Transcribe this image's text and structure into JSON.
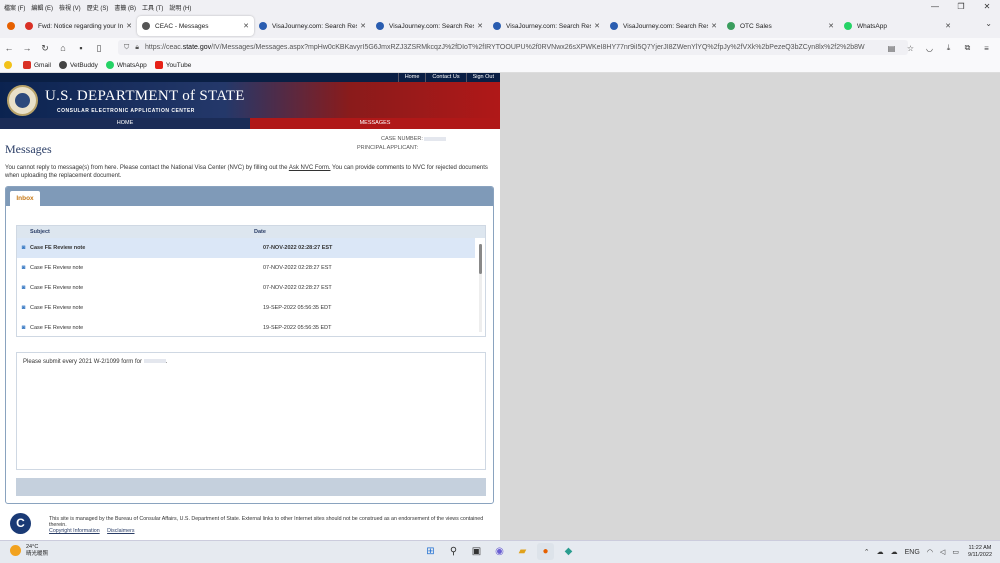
{
  "menubar": {
    "items": [
      "檔案 (F)",
      "編輯 (E)",
      "檢視 (V)",
      "歷史 (S)",
      "書籤 (B)",
      "工具 (T)",
      "說明 (H)"
    ]
  },
  "tabs": [
    {
      "label": "Fwd: Notice regarding your In",
      "color": "#d93025"
    },
    {
      "label": "CEAC - Messages",
      "color": "#555555",
      "active": true
    },
    {
      "label": "VisaJourney.com: Search Resu",
      "color": "#2a5db0"
    },
    {
      "label": "VisaJourney.com: Search Resu",
      "color": "#2a5db0"
    },
    {
      "label": "VisaJourney.com: Search Resu",
      "color": "#2a5db0"
    },
    {
      "label": "VisaJourney.com: Search Resu",
      "color": "#2a5db0"
    },
    {
      "label": "OTC Sales",
      "color": "#3a9d5d"
    },
    {
      "label": "WhatsApp",
      "color": "#25d366"
    }
  ],
  "url": {
    "prefix": "https://ceac.",
    "host": "state.gov",
    "path": "/IV/Messages/Messages.aspx?mpHw0cKBKavyrI5G6JmxRZJ3ZSRMkcqzJ%2fDIoT%2fIRYTOOUPU%2f0RVNwx26sXPWKeI8HY77nr9iI5Q7YjerJI8ZWenYlYQ%2fpJy%2fVXk%2bPezeQ3bZCyn8lx%2f2%2b8W"
  },
  "bookmarks": [
    {
      "label": "Gmail",
      "color": "#d93025"
    },
    {
      "label": "VetBuddy",
      "color": "#444444"
    },
    {
      "label": "WhatsApp",
      "color": "#25d366"
    },
    {
      "label": "YouTube",
      "color": "#e62117"
    }
  ],
  "site": {
    "top_links": [
      "Home",
      "Contact Us",
      "Sign Out"
    ],
    "dept_title": "U.S. DEPARTMENT of STATE",
    "dept_subtitle": "CONSULAR ELECTRONIC APPLICATION CENTER",
    "nav_home": "HOME",
    "nav_messages": "MESSAGES",
    "case_number_label": "CASE NUMBER:",
    "principal_applicant_label": "PRINCIPAL APPLICANT:",
    "page_title": "Messages",
    "notice_pre": "You cannot reply to message(s) from here.  Please contact the National Visa Center (NVC) by filling out the ",
    "notice_link": "Ask NVC Form.",
    "notice_post": "  You can provide comments to NVC for rejected documents when uploading the replacement document.",
    "inbox_tab": "Inbox",
    "col_subject": "Subject",
    "col_date": "Date",
    "messages": [
      {
        "subject": "Case FE Review note",
        "date": "07-NOV-2022 02:28:27 EST"
      },
      {
        "subject": "Case FE Review note",
        "date": "07-NOV-2022 02:28:27 EST"
      },
      {
        "subject": "Case FE Review note",
        "date": "07-NOV-2022 02:28:27 EST"
      },
      {
        "subject": "Case FE Review note",
        "date": "19-SEP-2022 05:56:35 EDT"
      },
      {
        "subject": "Case FE Review note",
        "date": "19-SEP-2022 05:56:35 EDT"
      }
    ],
    "message_body": "Please submit every 2021 W-2/1099 form for",
    "footer_text": "This site is managed by the Bureau of Consular Affairs, U.S. Department of State. External links to other Internet sites should not be construed as an endorsement of the views contained therein.",
    "footer_copyright": "Copyright Information",
    "footer_disclaimers": "Disclaimers"
  },
  "taskbar": {
    "temp": "24°C",
    "weather": "晴光暖照",
    "lang": "ENG",
    "time": "11:22 AM",
    "date": "9/11/2022"
  }
}
